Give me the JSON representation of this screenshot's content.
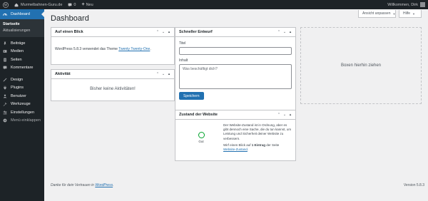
{
  "adminbar": {
    "site_name": "Murmelbahnen-Guru.de",
    "comments_count": "0",
    "new_label": "Neu",
    "greeting": "Willkommen, Dirk"
  },
  "sidebar": {
    "dashboard_label": "Dashboard",
    "sub_items": [
      {
        "label": "Startseite"
      },
      {
        "label": "Aktualisierungen"
      }
    ],
    "items": [
      {
        "label": "Beiträge",
        "icon": "pin-icon"
      },
      {
        "label": "Medien",
        "icon": "media-icon"
      },
      {
        "label": "Seiten",
        "icon": "page-icon"
      },
      {
        "label": "Kommentare",
        "icon": "comment-icon"
      },
      {
        "label": "Design",
        "icon": "brush-icon"
      },
      {
        "label": "Plugins",
        "icon": "plugin-icon"
      },
      {
        "label": "Benutzer",
        "icon": "user-icon"
      },
      {
        "label": "Werkzeuge",
        "icon": "wrench-icon"
      },
      {
        "label": "Einstellungen",
        "icon": "settings-icon"
      }
    ],
    "collapse_label": "Menü einklappen"
  },
  "header": {
    "title": "Dashboard",
    "screen_options": "Ansicht anpassen",
    "help": "Hilfe"
  },
  "glance": {
    "title": "Auf einen Blick",
    "text_prefix": "WordPress 5.8.3 verwendet das Theme ",
    "theme_link": "Twenty Twenty-One",
    "text_suffix": "."
  },
  "activity": {
    "title": "Aktivität",
    "empty": "Bisher keine Aktivitäten!"
  },
  "quickdraft": {
    "title": "Schneller Entwurf",
    "title_label": "Titel",
    "title_value": "",
    "content_label": "Inhalt",
    "content_placeholder": "Was beschäftigt dich?",
    "save_label": "Speichern"
  },
  "dropzone": {
    "label": "Boxen hierhin ziehen"
  },
  "health": {
    "title": "Zustand der Website",
    "status": "Gut",
    "text": "Der Website-Zustand ist in Ordnung, aber es gibt dennoch eine Sache, die du tun kannst, um Leistung und Sicherheit deiner Website zu verbessern.",
    "hint_prefix": "Wirf einen Blick auf ",
    "hint_bold": "1 Eintrag",
    "hint_mid": " der Seite ",
    "hint_link": "Website-Zustand",
    "hint_suffix": "."
  },
  "footer": {
    "thanks_prefix": "Danke für dein Vertrauen in ",
    "thanks_link": "WordPress",
    "thanks_suffix": ".",
    "version": "Version 5.8.3"
  },
  "colors": {
    "accent": "#2271b1",
    "adminbar_bg": "#1d2327",
    "health_good": "#00a32a"
  }
}
